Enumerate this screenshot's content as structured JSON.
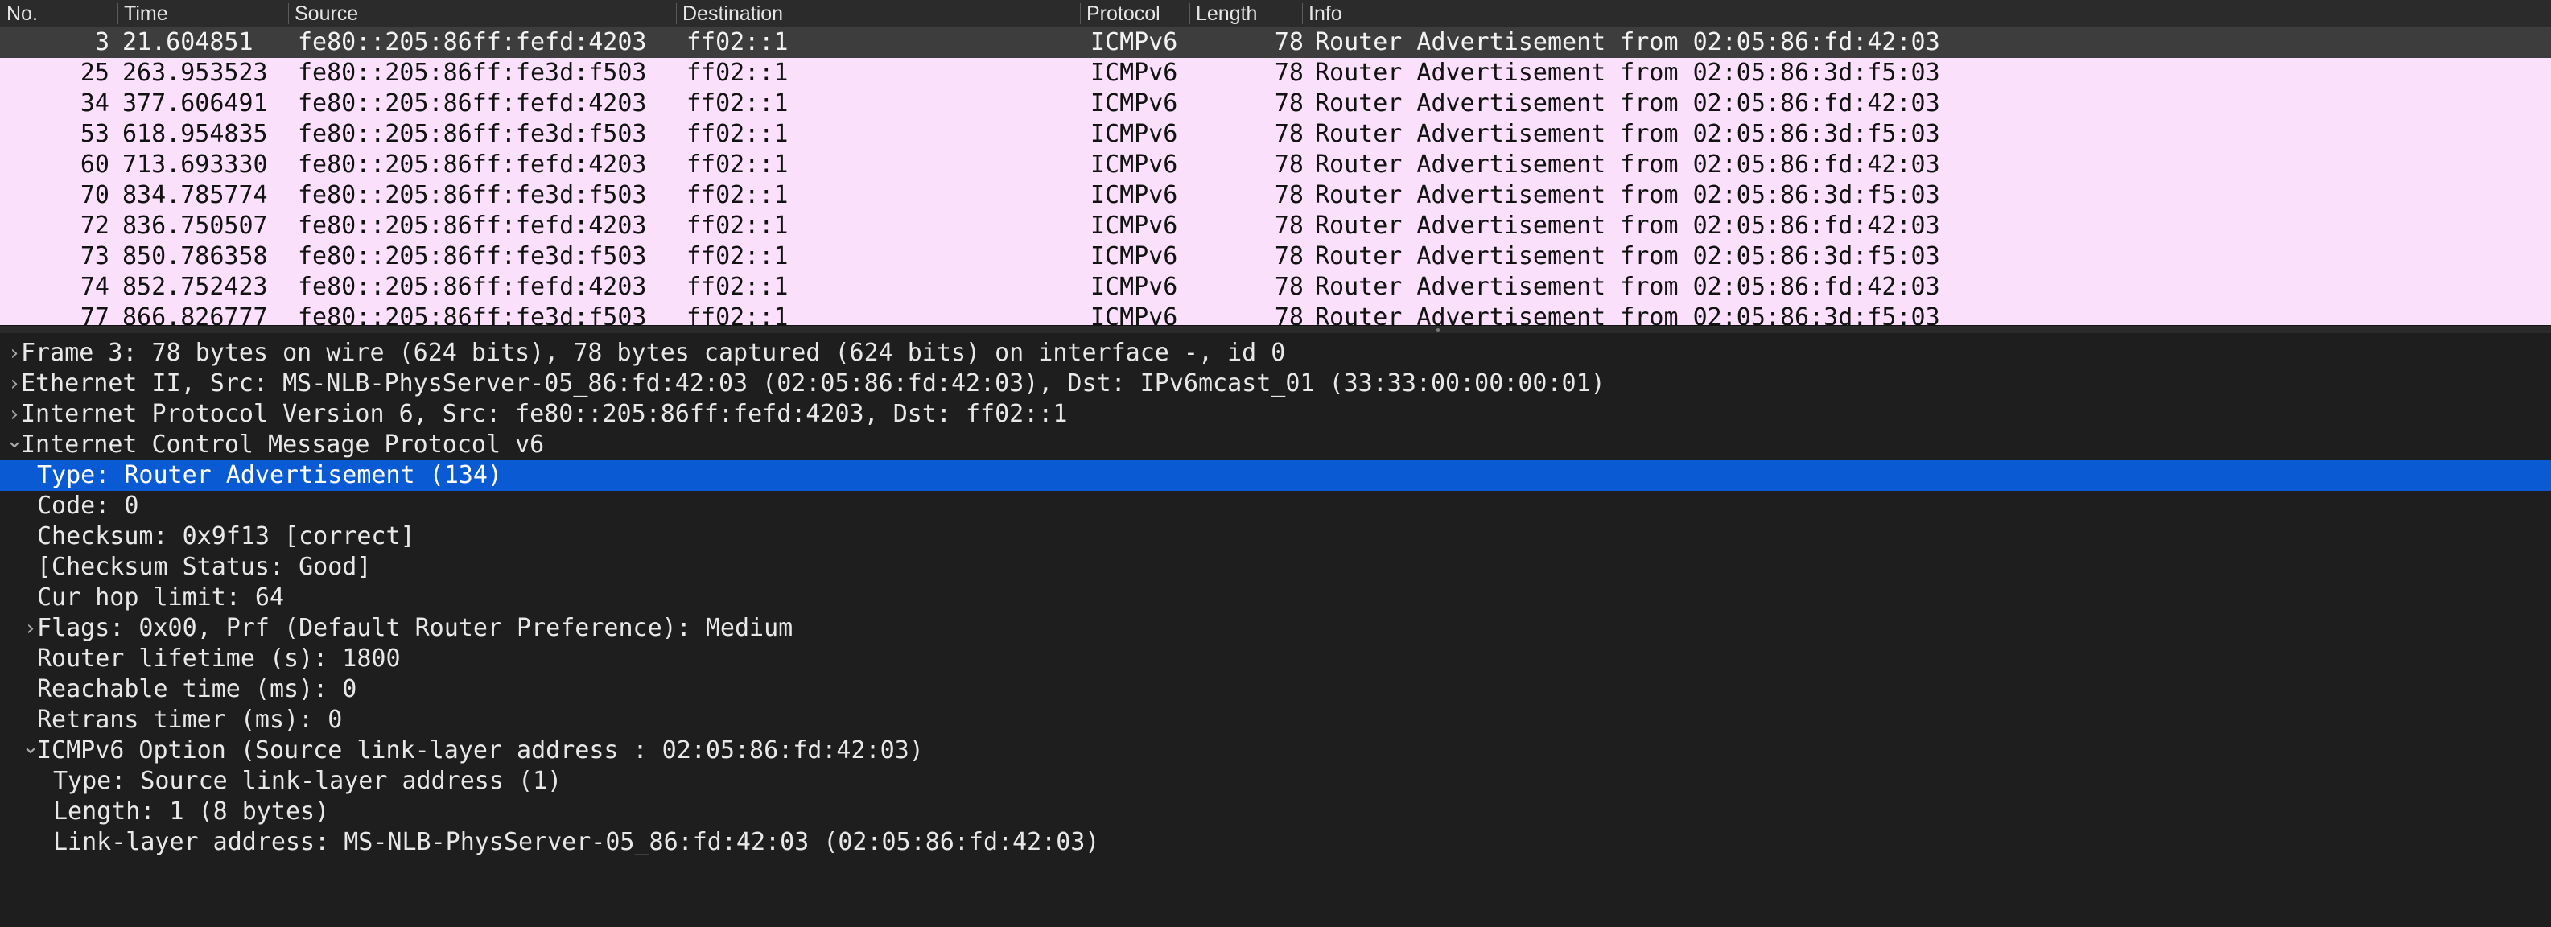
{
  "packet_list": {
    "columns": [
      "No.",
      "Time",
      "Source",
      "Destination",
      "Protocol",
      "Length",
      "Info"
    ],
    "rows": [
      {
        "no": "3",
        "time": "21.604851",
        "source": "fe80::205:86ff:fefd:4203",
        "destination": "ff02::1",
        "protocol": "ICMPv6",
        "length": "78",
        "info": "Router Advertisement from 02:05:86:fd:42:03",
        "selected": true
      },
      {
        "no": "25",
        "time": "263.953523",
        "source": "fe80::205:86ff:fe3d:f503",
        "destination": "ff02::1",
        "protocol": "ICMPv6",
        "length": "78",
        "info": "Router Advertisement from 02:05:86:3d:f5:03"
      },
      {
        "no": "34",
        "time": "377.606491",
        "source": "fe80::205:86ff:fefd:4203",
        "destination": "ff02::1",
        "protocol": "ICMPv6",
        "length": "78",
        "info": "Router Advertisement from 02:05:86:fd:42:03"
      },
      {
        "no": "53",
        "time": "618.954835",
        "source": "fe80::205:86ff:fe3d:f503",
        "destination": "ff02::1",
        "protocol": "ICMPv6",
        "length": "78",
        "info": "Router Advertisement from 02:05:86:3d:f5:03"
      },
      {
        "no": "60",
        "time": "713.693330",
        "source": "fe80::205:86ff:fefd:4203",
        "destination": "ff02::1",
        "protocol": "ICMPv6",
        "length": "78",
        "info": "Router Advertisement from 02:05:86:fd:42:03"
      },
      {
        "no": "70",
        "time": "834.785774",
        "source": "fe80::205:86ff:fe3d:f503",
        "destination": "ff02::1",
        "protocol": "ICMPv6",
        "length": "78",
        "info": "Router Advertisement from 02:05:86:3d:f5:03"
      },
      {
        "no": "72",
        "time": "836.750507",
        "source": "fe80::205:86ff:fefd:4203",
        "destination": "ff02::1",
        "protocol": "ICMPv6",
        "length": "78",
        "info": "Router Advertisement from 02:05:86:fd:42:03"
      },
      {
        "no": "73",
        "time": "850.786358",
        "source": "fe80::205:86ff:fe3d:f503",
        "destination": "ff02::1",
        "protocol": "ICMPv6",
        "length": "78",
        "info": "Router Advertisement from 02:05:86:3d:f5:03"
      },
      {
        "no": "74",
        "time": "852.752423",
        "source": "fe80::205:86ff:fefd:4203",
        "destination": "ff02::1",
        "protocol": "ICMPv6",
        "length": "78",
        "info": "Router Advertisement from 02:05:86:fd:42:03"
      },
      {
        "no": "77",
        "time": "866.826777",
        "source": "fe80::205:86ff:fe3d:f503",
        "destination": "ff02::1",
        "protocol": "ICMPv6",
        "length": "78",
        "info": "Router Advertisement from 02:05:86:3d:f5:03"
      }
    ]
  },
  "packet_details": {
    "lines": [
      {
        "text": "Frame 3: 78 bytes on wire (624 bits), 78 bytes captured (624 bits) on interface -, id 0",
        "depth": 0,
        "expander": "collapsed"
      },
      {
        "text": "Ethernet II, Src: MS-NLB-PhysServer-05_86:fd:42:03 (02:05:86:fd:42:03), Dst: IPv6mcast_01 (33:33:00:00:00:01)",
        "depth": 0,
        "expander": "collapsed"
      },
      {
        "text": "Internet Protocol Version 6, Src: fe80::205:86ff:fefd:4203, Dst: ff02::1",
        "depth": 0,
        "expander": "collapsed"
      },
      {
        "text": "Internet Control Message Protocol v6",
        "depth": 0,
        "expander": "expanded"
      },
      {
        "text": "Type: Router Advertisement (134)",
        "depth": 1,
        "expander": "none",
        "selected": true
      },
      {
        "text": "Code: 0",
        "depth": 1,
        "expander": "none"
      },
      {
        "text": "Checksum: 0x9f13 [correct]",
        "depth": 1,
        "expander": "none"
      },
      {
        "text": "[Checksum Status: Good]",
        "depth": 1,
        "expander": "none"
      },
      {
        "text": "Cur hop limit: 64",
        "depth": 1,
        "expander": "none"
      },
      {
        "text": "Flags: 0x00, Prf (Default Router Preference): Medium",
        "depth": 1,
        "expander": "collapsed"
      },
      {
        "text": "Router lifetime (s): 1800",
        "depth": 1,
        "expander": "none"
      },
      {
        "text": "Reachable time (ms): 0",
        "depth": 1,
        "expander": "none"
      },
      {
        "text": "Retrans timer (ms): 0",
        "depth": 1,
        "expander": "none"
      },
      {
        "text": "ICMPv6 Option (Source link-layer address : 02:05:86:fd:42:03)",
        "depth": 1,
        "expander": "expanded"
      },
      {
        "text": "Type: Source link-layer address (1)",
        "depth": 2,
        "expander": "none"
      },
      {
        "text": "Length: 1 (8 bytes)",
        "depth": 2,
        "expander": "none"
      },
      {
        "text": "Link-layer address: MS-NLB-PhysServer-05_86:fd:42:03 (02:05:86:fd:42:03)",
        "depth": 2,
        "expander": "none"
      }
    ]
  },
  "icons": {
    "collapsed": "chevron-right-icon",
    "expanded": "chevron-down-icon"
  },
  "colors": {
    "list_background": "#fbe0fb",
    "list_selected": "#3d3d3d",
    "details_background": "#1e1e1e",
    "details_selected": "#0a5ad4"
  }
}
